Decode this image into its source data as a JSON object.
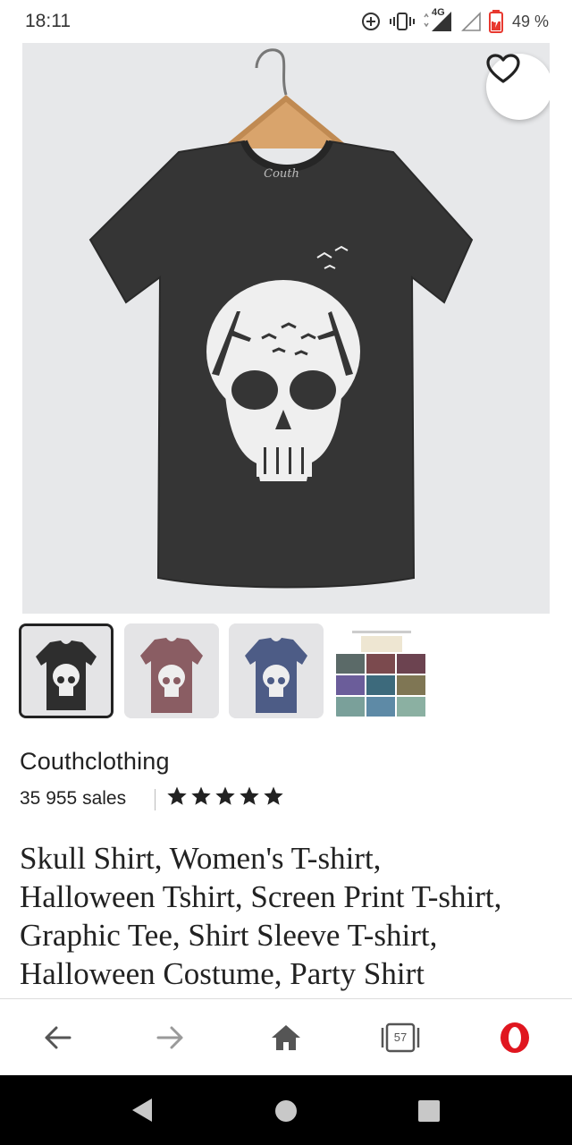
{
  "status_bar": {
    "time": "18:11",
    "network": "4G",
    "battery": "49 %"
  },
  "product": {
    "shop_name": "Couthclothing",
    "sales": "35 955 sales",
    "rating_stars": 5,
    "title_lines": [
      "Skull Shirt, Women's T-shirt,",
      "Halloween Tshirt, Screen Print T-shirt,",
      "Graphic Tee, Shirt Sleeve T-shirt,",
      "Halloween Costume, Party Shirt"
    ],
    "label_brand": "Couth"
  },
  "thumbnails": [
    {
      "color": "#2e2e2e",
      "selected": true
    },
    {
      "color": "#8a5d63",
      "selected": false
    },
    {
      "color": "#4d5c86",
      "selected": false
    },
    {
      "color": "multi",
      "selected": false
    }
  ],
  "browser": {
    "tab_count": "57"
  },
  "icons": [
    "heart-icon",
    "back-arrow-icon",
    "forward-arrow-icon",
    "home-icon",
    "tabs-icon",
    "opera-icon"
  ],
  "colors": {
    "opera_red": "#e0161f",
    "star": "#222222"
  }
}
